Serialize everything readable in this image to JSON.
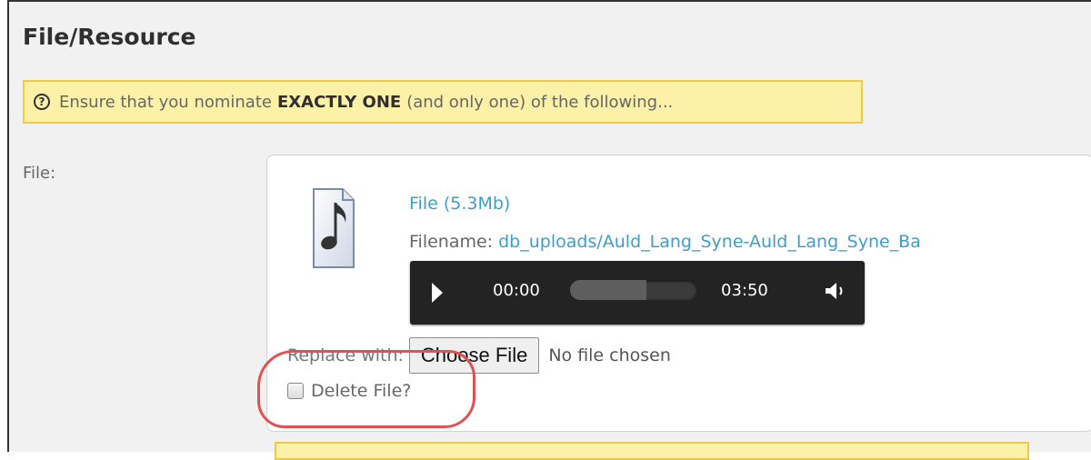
{
  "panel": {
    "title": "File/Resource"
  },
  "instruction": {
    "icon": "question-circle-icon",
    "text_before": "Ensure that you nominate",
    "emphasis": "EXACTLY ONE",
    "text_after": "(and only one) of the following..."
  },
  "file_field": {
    "label": "File:",
    "icon": "audio-file-icon",
    "file_link": "File (5.3Mb)",
    "filename_label": "Filename:",
    "filename_value": "db_uploads/Auld_Lang_Syne-Auld_Lang_Syne_Ba",
    "player": {
      "current_time": "00:00",
      "total_time": "03:50",
      "loaded_fraction": 0.6,
      "play_icon": "play-icon",
      "volume_icon": "volume-icon"
    },
    "replace_label": "Replace with:",
    "choose_file_button": "Choose File",
    "no_file_text": "No file chosen",
    "delete_label": "Delete File?",
    "delete_checked": false
  },
  "colors": {
    "accent_link": "#3d9fc8",
    "note_bg": "#fdf1a8",
    "note_border": "#f1c84b",
    "highlight": "#e05252"
  }
}
